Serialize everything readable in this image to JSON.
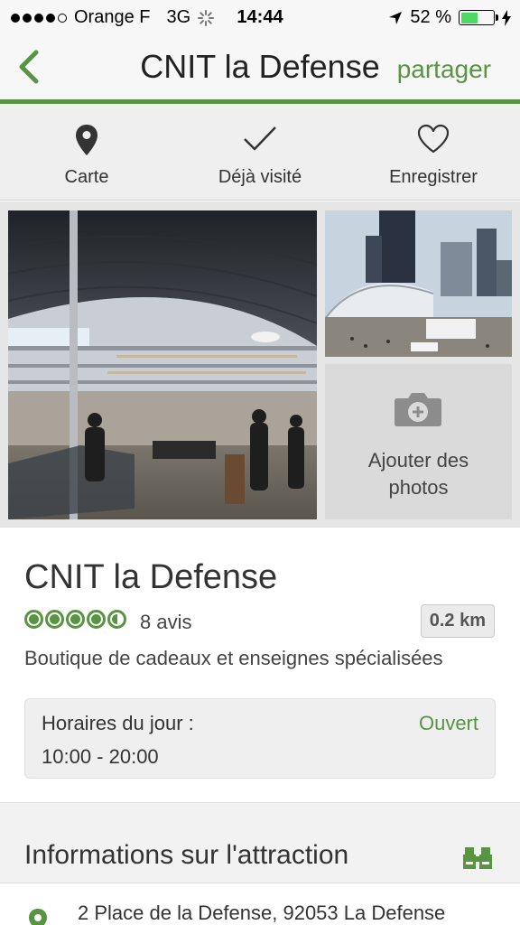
{
  "status_bar": {
    "carrier": "Orange F",
    "network": "3G",
    "time": "14:44",
    "battery_percent": "52 %",
    "battery_level": 0.52,
    "signal_bars_filled": 4,
    "signal_bars_total": 5
  },
  "nav": {
    "title": "CNIT la Defense",
    "share_label": "partager",
    "back_icon": "chevron-left-icon"
  },
  "actions": [
    {
      "label": "Carte",
      "icon": "map-pin-icon"
    },
    {
      "label": "Déjà visité",
      "icon": "checkmark-icon"
    },
    {
      "label": "Enregistrer",
      "icon": "heart-icon"
    }
  ],
  "photos": {
    "add_label": "Ajouter des photos",
    "add_icon": "camera-plus-icon"
  },
  "place": {
    "name": "CNIT la Defense",
    "rating": 4.5,
    "rating_max": 5,
    "reviews": "8 avis",
    "distance": "0.2 km",
    "category": "Boutique de cadeaux et enseignes spécialisées"
  },
  "hours": {
    "label": "Horaires du jour :",
    "status": "Ouvert",
    "time": "10:00 - 20:00"
  },
  "info": {
    "title": "Informations sur l'attraction",
    "icon": "binoculars-icon",
    "address": "2 Place de la Defense, 92053 La Defense",
    "address_icon": "location-pin-icon"
  },
  "colors": {
    "accent": "#589442",
    "battery": "#4cd964"
  }
}
